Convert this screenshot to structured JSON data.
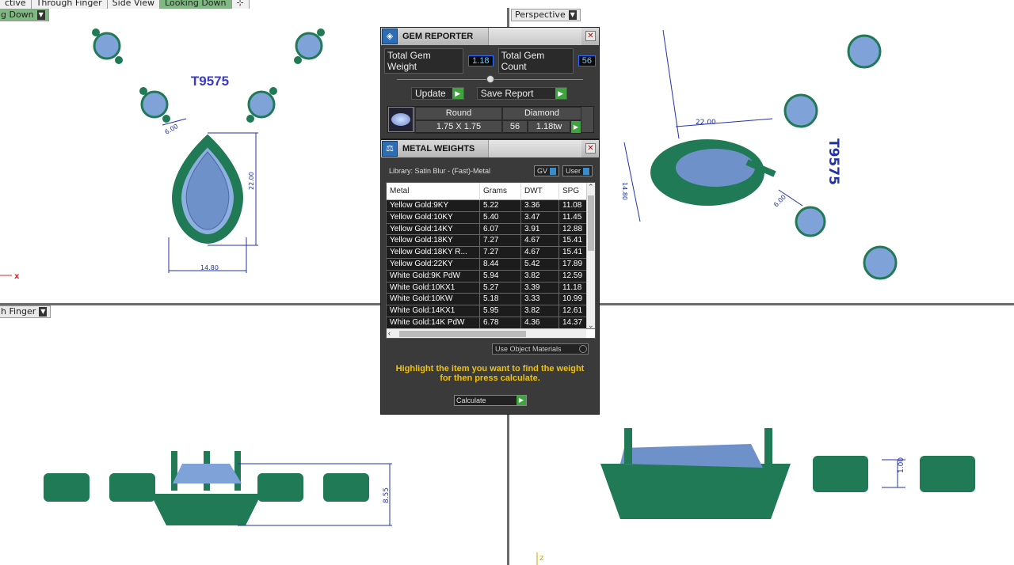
{
  "top_left_tabs": [
    "ctive",
    "Through Finger",
    "Side View",
    "Looking Down"
  ],
  "viewports": {
    "top_left_label": "g Down",
    "top_right_label": "Perspective",
    "bottom_left_label": "h Finger"
  },
  "model": {
    "part_number": "T9575",
    "dim_width": "14.80",
    "dim_height": "22.00",
    "dim_link": "6.00",
    "dim_side_height": "8.55",
    "dim_persp_width": "22.00",
    "dim_persp_depth": "14.80",
    "dim_persp_link": "6.00",
    "dim_persp_thickness": "1.00",
    "persp_part_number": "T9575",
    "axis_x": "x",
    "axis_z": "z"
  },
  "gem_reporter": {
    "title": "GEM REPORTER",
    "total_weight_label": "Total Gem Weight",
    "total_weight_value": "1.18",
    "total_count_label": "Total Gem Count",
    "total_count_value": "56",
    "update_label": "Update",
    "save_report_label": "Save Report",
    "shape": "Round",
    "material": "Diamond",
    "size": "1.75 X 1.75",
    "count": "56",
    "weight": "1.18tw"
  },
  "metal_weights": {
    "title": "METAL WEIGHTS",
    "library": "Library: Satin Blur - (Fast)-Metal",
    "gv_label": "GV",
    "user_label": "User",
    "columns": [
      "Metal",
      "Grams",
      "DWT",
      "SPG"
    ],
    "rows": [
      [
        "Yellow Gold:9KY",
        "5.22",
        "3.36",
        "11.08"
      ],
      [
        "Yellow Gold:10KY",
        "5.40",
        "3.47",
        "11.45"
      ],
      [
        "Yellow Gold:14KY",
        "6.07",
        "3.91",
        "12.88"
      ],
      [
        "Yellow Gold:18KY",
        "7.27",
        "4.67",
        "15.41"
      ],
      [
        "Yellow Gold:18KY R...",
        "7.27",
        "4.67",
        "15.41"
      ],
      [
        "Yellow Gold:22KY",
        "8.44",
        "5.42",
        "17.89"
      ],
      [
        "White Gold:9K PdW",
        "5.94",
        "3.82",
        "12.59"
      ],
      [
        "White Gold:10KX1",
        "5.27",
        "3.39",
        "11.18"
      ],
      [
        "White Gold:10KW",
        "5.18",
        "3.33",
        "10.99"
      ],
      [
        "White Gold:14KX1",
        "5.95",
        "3.82",
        "12.61"
      ],
      [
        "White Gold:14K PdW",
        "6.78",
        "4.36",
        "14.37"
      ]
    ],
    "use_object_materials": "Use Object Materials",
    "hint_line1": "Highlight the item you want to find the weight",
    "hint_line2": "for then press calculate.",
    "calculate_label": "Calculate"
  },
  "colors": {
    "metal_green": "#1f7a55",
    "gem_blue": "#7fa3d8",
    "dim_line": "#2233aa",
    "text_blue": "#3a3acc",
    "hint_yellow": "#f2c200"
  }
}
